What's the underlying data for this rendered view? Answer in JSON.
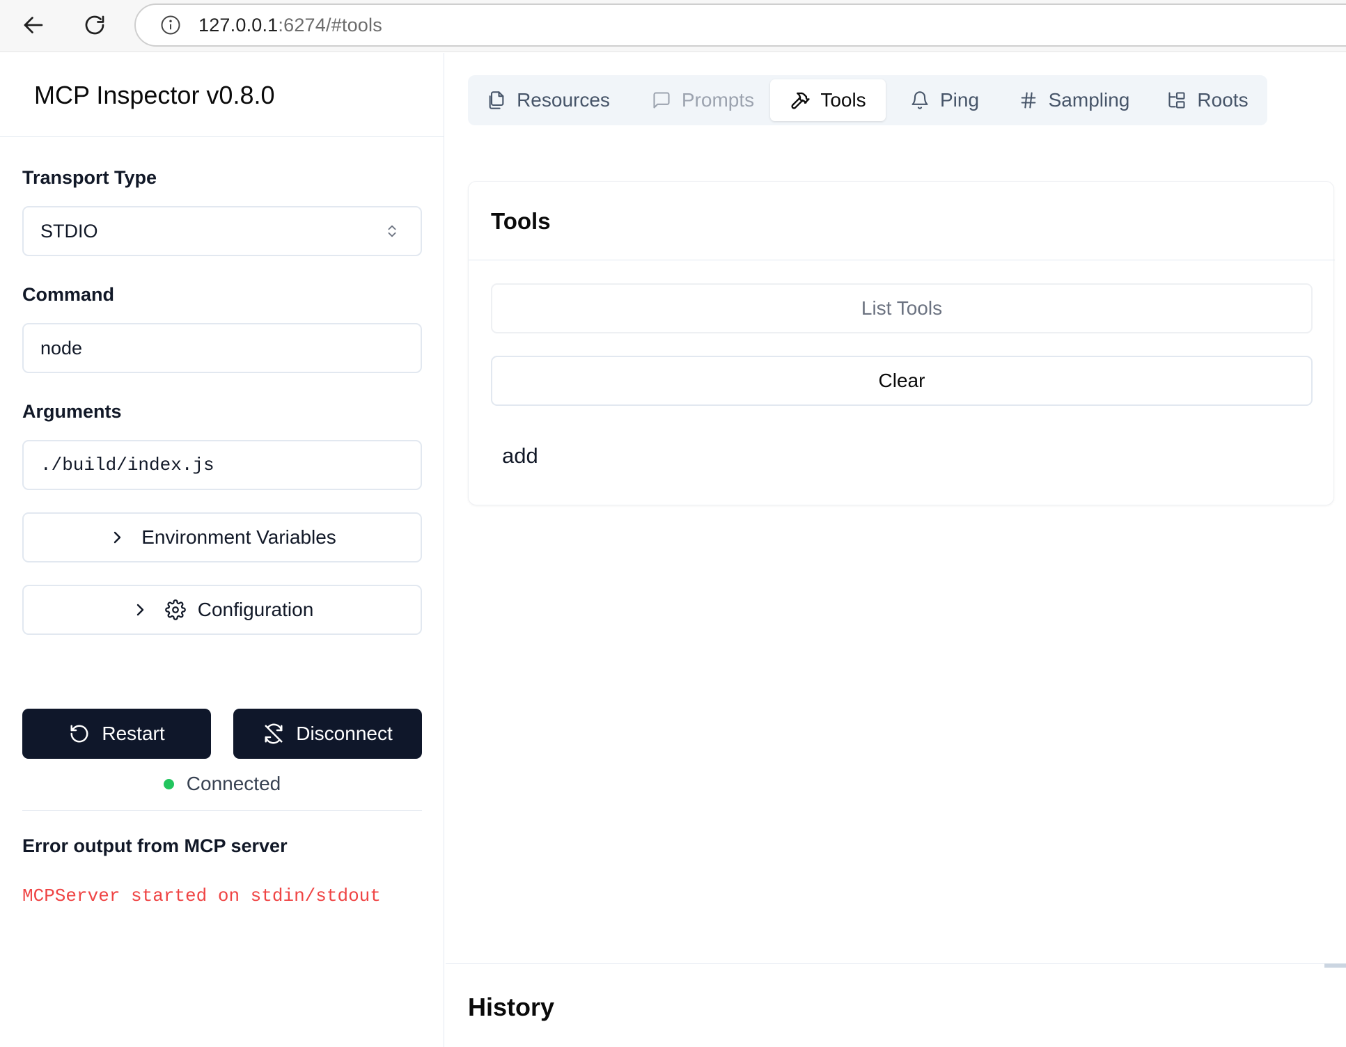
{
  "browser": {
    "url_host": "127.0.0.1",
    "url_rest": ":6274/#tools"
  },
  "sidebar": {
    "title": "MCP Inspector v0.8.0",
    "transport": {
      "label": "Transport Type",
      "value": "STDIO"
    },
    "command": {
      "label": "Command",
      "value": "node"
    },
    "arguments": {
      "label": "Arguments",
      "value": "./build/index.js"
    },
    "env_vars_label": "Environment Variables",
    "configuration_label": "Configuration",
    "restart_label": "Restart",
    "disconnect_label": "Disconnect",
    "status": {
      "text": "Connected",
      "color": "#22c55e"
    },
    "error_output": {
      "title": "Error output from MCP server",
      "text": "MCPServer started on stdin/stdout"
    }
  },
  "tabs": [
    {
      "label": "Resources",
      "icon": "files-icon",
      "state": "normal"
    },
    {
      "label": "Prompts",
      "icon": "message-square-icon",
      "state": "disabled"
    },
    {
      "label": "Tools",
      "icon": "hammer-icon",
      "state": "active"
    },
    {
      "label": "Ping",
      "icon": "bell-icon",
      "state": "normal"
    },
    {
      "label": "Sampling",
      "icon": "hash-icon",
      "state": "normal"
    },
    {
      "label": "Roots",
      "icon": "folder-tree-icon",
      "state": "normal"
    }
  ],
  "tools_panel": {
    "title": "Tools",
    "list_label": "List Tools",
    "clear_label": "Clear",
    "items": [
      "add"
    ]
  },
  "history": {
    "title": "History"
  },
  "colors": {
    "accent_dark": "#0f172a",
    "error": "#ef4444"
  }
}
